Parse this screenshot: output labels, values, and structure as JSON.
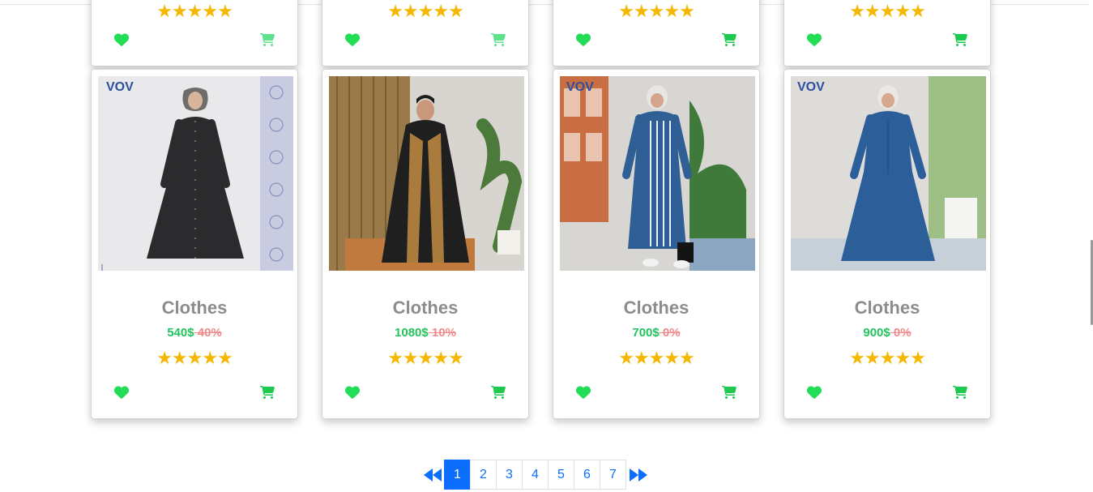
{
  "colors": {
    "accent": "#0d6efd",
    "price": "#22c55e",
    "discount": "#f08a8a",
    "star": "#f5b800",
    "heart": "#22dd55",
    "cart_top": "#5de18a",
    "cart": "#1ec94f"
  },
  "stars_glyph": "★★★★★",
  "top_cards": [
    {
      "stars": "★★★★★"
    },
    {
      "stars": "★★★★★"
    },
    {
      "stars": "★★★★★"
    },
    {
      "stars": "★★★★★"
    }
  ],
  "products": [
    {
      "title": "Clothes",
      "price": "540$",
      "discount": " 40%",
      "stars": "★★★★★",
      "image": "black-denim-abaya-photo",
      "code": "4089"
    },
    {
      "title": "Clothes",
      "price": "1080$",
      "discount": " 10%",
      "stars": "★★★★★",
      "image": "black-abaya-leopard-trim-photo"
    },
    {
      "title": "Clothes",
      "price": "700$",
      "discount": " 0%",
      "stars": "★★★★★",
      "image": "blue-striped-denim-dress-photo",
      "code": "5051"
    },
    {
      "title": "Clothes",
      "price": "900$",
      "discount": " 0%",
      "stars": "★★★★★",
      "image": "blue-denim-dress-photo",
      "code": "6010"
    }
  ],
  "pagination": {
    "pages": [
      "1",
      "2",
      "3",
      "4",
      "5",
      "6",
      "7"
    ],
    "active": "1"
  },
  "icons": {
    "heart": "heart-icon",
    "cart": "cart-icon",
    "prev": "fast-backward-icon",
    "next": "fast-forward-icon"
  }
}
